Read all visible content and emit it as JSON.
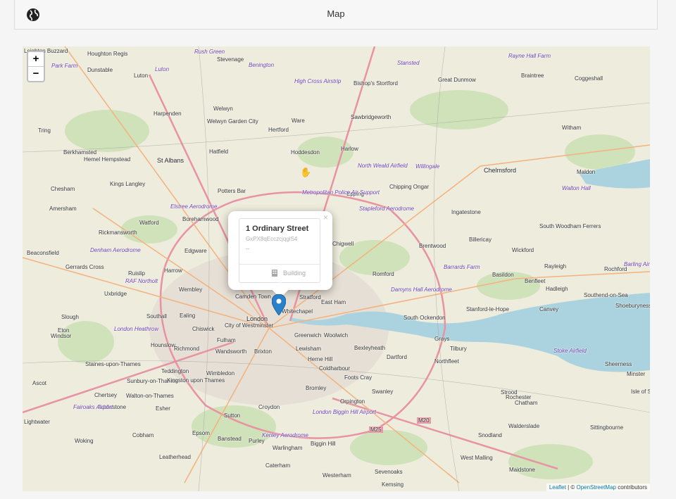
{
  "header": {
    "title": "Map",
    "icon": "globe-icon"
  },
  "zoom": {
    "in_label": "+",
    "out_label": "−"
  },
  "popup": {
    "street": "1 Ordinary Street",
    "code": "GxPX8qEcczcjqgiS4",
    "dash": "--",
    "type_label": "Building",
    "close_label": "×"
  },
  "attribution": {
    "leaflet": "Leaflet",
    "sep": " | © ",
    "osm": "OpenStreetMap",
    "suffix": " contributors"
  },
  "colors": {
    "water": "#aad3df",
    "land": "#eeecdc",
    "park": "#c8e0b2",
    "motorway": "#e892a2",
    "primary": "#fcd6a4",
    "accent": "#2a81cb"
  },
  "places": [
    {
      "name": "Leighton Buzzard"
    },
    {
      "name": "Houghton Regis"
    },
    {
      "name": "Dunstable"
    },
    {
      "name": "Luton"
    },
    {
      "name": "Stevenage"
    },
    {
      "name": "Bishop's Stortford"
    },
    {
      "name": "Great Dunmow"
    },
    {
      "name": "Braintree"
    },
    {
      "name": "Coggeshall"
    },
    {
      "name": "Harpenden"
    },
    {
      "name": "Welwyn"
    },
    {
      "name": "Welwyn Garden City"
    },
    {
      "name": "Hertford"
    },
    {
      "name": "Ware"
    },
    {
      "name": "Sawbridgeworth"
    },
    {
      "name": "Witham"
    },
    {
      "name": "Tring"
    },
    {
      "name": "Berkhamsted"
    },
    {
      "name": "Hemel Hempstead"
    },
    {
      "name": "St Albans"
    },
    {
      "name": "Hatfield"
    },
    {
      "name": "Hoddesdon"
    },
    {
      "name": "Harlow"
    },
    {
      "name": "Chelmsford"
    },
    {
      "name": "Maldon"
    },
    {
      "name": "Kings Langley"
    },
    {
      "name": "Potters Bar"
    },
    {
      "name": "Epping"
    },
    {
      "name": "Chipping Ongar"
    },
    {
      "name": "Chesham"
    },
    {
      "name": "Amersham"
    },
    {
      "name": "Watford"
    },
    {
      "name": "Borehamwood"
    },
    {
      "name": "Ingatestone"
    },
    {
      "name": "South Woodham Ferrers"
    },
    {
      "name": "Rickmansworth"
    },
    {
      "name": "Chigwell"
    },
    {
      "name": "Brentwood"
    },
    {
      "name": "Billericay"
    },
    {
      "name": "Wickford"
    },
    {
      "name": "Beaconsfield"
    },
    {
      "name": "Gerrards Cross"
    },
    {
      "name": "Edgware"
    },
    {
      "name": "Romford"
    },
    {
      "name": "Rayleigh"
    },
    {
      "name": "Rochford"
    },
    {
      "name": "Ruislip"
    },
    {
      "name": "Harrow"
    },
    {
      "name": "Basildon"
    },
    {
      "name": "Benfleet"
    },
    {
      "name": "Uxbridge"
    },
    {
      "name": "Wembley"
    },
    {
      "name": "Hadleigh"
    },
    {
      "name": "Southend-on-Sea"
    },
    {
      "name": "Shoeburyness"
    },
    {
      "name": "Slough"
    },
    {
      "name": "Southall"
    },
    {
      "name": "Ealing"
    },
    {
      "name": "London"
    },
    {
      "name": "City of Westminster"
    },
    {
      "name": "Stratford"
    },
    {
      "name": "East Ham"
    },
    {
      "name": "Whitechapel"
    },
    {
      "name": "Camden Town"
    },
    {
      "name": "Canvey"
    },
    {
      "name": "Stanford-le-Hope"
    },
    {
      "name": "South Ockendon"
    },
    {
      "name": "Eton"
    },
    {
      "name": "Windsor"
    },
    {
      "name": "Chiswick"
    },
    {
      "name": "Greenwich"
    },
    {
      "name": "Woolwich"
    },
    {
      "name": "Hounslow"
    },
    {
      "name": "Richmond"
    },
    {
      "name": "Fulham"
    },
    {
      "name": "Wandsworth"
    },
    {
      "name": "Brixton"
    },
    {
      "name": "Lewisham"
    },
    {
      "name": "Bexleyheath"
    },
    {
      "name": "Dartford"
    },
    {
      "name": "Grays"
    },
    {
      "name": "Tilbury"
    },
    {
      "name": "Northfleet"
    },
    {
      "name": "Sheerness"
    },
    {
      "name": "Minster"
    },
    {
      "name": "Staines-upon-Thames"
    },
    {
      "name": "Teddington"
    },
    {
      "name": "Wimbledon"
    },
    {
      "name": "Herne Hill"
    },
    {
      "name": "Coldharbour"
    },
    {
      "name": "Foots Cray"
    },
    {
      "name": "Sunbury-on-Thames"
    },
    {
      "name": "Kingston upon Thames"
    },
    {
      "name": "Bromley"
    },
    {
      "name": "Ascot"
    },
    {
      "name": "Chertsey"
    },
    {
      "name": "Walton-on-Thames"
    },
    {
      "name": "Swanley"
    },
    {
      "name": "Strood"
    },
    {
      "name": "Rochester"
    },
    {
      "name": "Chatham"
    },
    {
      "name": "Isle of Sheppey"
    },
    {
      "name": "Addlestone"
    },
    {
      "name": "Esher"
    },
    {
      "name": "Sutton"
    },
    {
      "name": "Croydon"
    },
    {
      "name": "Orpington"
    },
    {
      "name": "Lightwater"
    },
    {
      "name": "Walderslade"
    },
    {
      "name": "Sittingbourne"
    },
    {
      "name": "Woking"
    },
    {
      "name": "Cobham"
    },
    {
      "name": "Epsom"
    },
    {
      "name": "Banstead"
    },
    {
      "name": "Purley"
    },
    {
      "name": "Warlingham"
    },
    {
      "name": "Biggin Hill"
    },
    {
      "name": "Snodland"
    },
    {
      "name": "Leatherhead"
    },
    {
      "name": "West Malling"
    },
    {
      "name": "Caterham"
    },
    {
      "name": "Sevenoaks"
    },
    {
      "name": "Maidstone"
    },
    {
      "name": "Westerham"
    },
    {
      "name": "Kemsing"
    },
    {
      "name": "M25"
    },
    {
      "name": "M20"
    }
  ],
  "airports": [
    {
      "name": "Rush Green"
    },
    {
      "name": "Benington"
    },
    {
      "name": "Stansted"
    },
    {
      "name": "Rayne Hall Farm"
    },
    {
      "name": "Park Farm"
    },
    {
      "name": "Luton"
    },
    {
      "name": "High Cross Airstrip"
    },
    {
      "name": "North Weald Airfield"
    },
    {
      "name": "Willingale"
    },
    {
      "name": "Walton Hall"
    },
    {
      "name": "Metropolitan Police Air Support"
    },
    {
      "name": "Stapleford Aerodrome"
    },
    {
      "name": "Elstree Aerodrome"
    },
    {
      "name": "Denham Aerodrome"
    },
    {
      "name": "RAF Northolt"
    },
    {
      "name": "Barrards Farm"
    },
    {
      "name": "Barling Airstrip"
    },
    {
      "name": "Damyns Hall Aerodrome"
    },
    {
      "name": "London Heathrow"
    },
    {
      "name": "Stoke Airfield"
    },
    {
      "name": "Fairoaks Airport"
    },
    {
      "name": "London Biggin Hill Airport"
    },
    {
      "name": "Kenley Aerodrome"
    }
  ]
}
